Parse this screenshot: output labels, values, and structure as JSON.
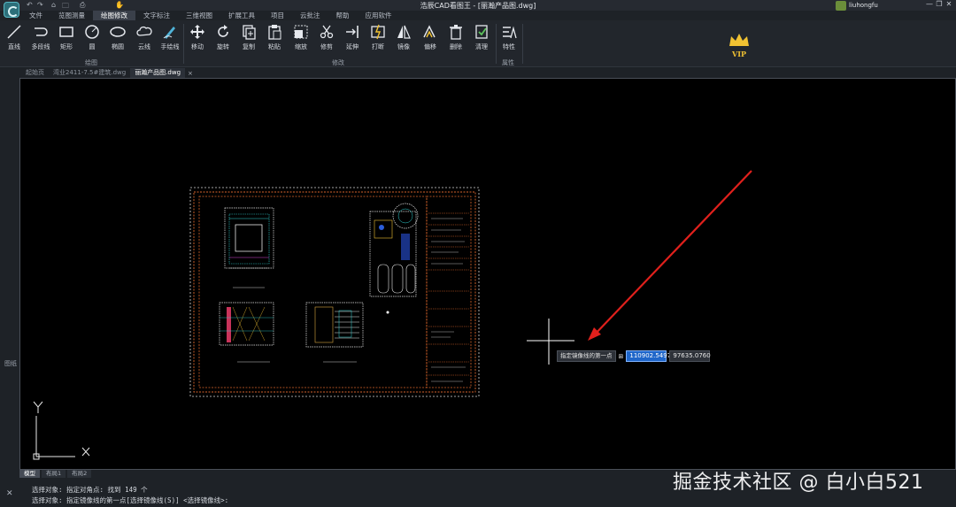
{
  "window": {
    "title": "浩辰CAD看图王 - [丽瀚产品图.dwg]",
    "user_name": "liuhongfu",
    "controls": [
      "—",
      "❐",
      "✕"
    ]
  },
  "quick_access": [
    "↶",
    "↷",
    "⌂",
    "⎙",
    "🗀",
    "✋"
  ],
  "menu": [
    "文件",
    "览图测量",
    "绘图修改",
    "文字标注",
    "三维视图",
    "扩展工具",
    "项目",
    "云批注",
    "帮助",
    "应用软件"
  ],
  "menu_active_index": 2,
  "ribbon": {
    "draw_tools": [
      {
        "label": "直线",
        "icon": "line-icon"
      },
      {
        "label": "多段线",
        "icon": "polyline-icon"
      },
      {
        "label": "矩形",
        "icon": "rectangle-icon"
      },
      {
        "label": "圆",
        "icon": "circle-icon"
      },
      {
        "label": "椭圆",
        "icon": "ellipse-icon"
      },
      {
        "label": "云线",
        "icon": "cloud-icon"
      },
      {
        "label": "手绘线",
        "icon": "pen-icon"
      }
    ],
    "modify_tools": [
      {
        "label": "移动",
        "icon": "move-icon"
      },
      {
        "label": "旋转",
        "icon": "rotate-icon"
      },
      {
        "label": "复制",
        "icon": "copy-icon"
      },
      {
        "label": "粘贴",
        "icon": "paste-icon"
      },
      {
        "label": "缩放",
        "icon": "scale-icon"
      },
      {
        "label": "修剪",
        "icon": "trim-icon"
      },
      {
        "label": "延伸",
        "icon": "extend-icon"
      },
      {
        "label": "打断",
        "icon": "break-icon"
      },
      {
        "label": "镜像",
        "icon": "mirror-icon"
      },
      {
        "label": "偏移",
        "icon": "offset-icon"
      },
      {
        "label": "删除",
        "icon": "delete-icon"
      },
      {
        "label": "清理",
        "icon": "purge-icon"
      }
    ],
    "property_tools": [
      {
        "label": "特性",
        "icon": "properties-icon"
      }
    ],
    "groups": {
      "draw": "绘图",
      "modify": "修改",
      "properties": "属性"
    },
    "vip_label": "VIP"
  },
  "doc_tabs": [
    "起始页",
    "湾业2411-7.5#建筑.dwg",
    "丽瀚产品图.dwg"
  ],
  "doc_tab_active_index": 2,
  "tab_close": "×",
  "leftstrip_label": "图纸",
  "canvas": {
    "axis_y_label": "Y",
    "axis_x_label": "X"
  },
  "dynamic_input": {
    "prompt": "指定镜像线的第一点",
    "lock": "⊞",
    "x_value": "110902.5497",
    "y_value": "97635.0760"
  },
  "layout_tabs": [
    "模型",
    "布局1",
    "布局2"
  ],
  "layout_tab_active_index": 0,
  "command_history": [
    "选择对象: 指定对角点: 找到 149 个",
    "选择对象: 指定镜像线的第一点[选择镜像线(S)] <选择镜像线>:"
  ],
  "command_close": "✕",
  "watermark": "掘金技术社区 @ 白小白521",
  "colors": {
    "accent_blue": "#1f66c9",
    "arrow_red": "#e0201c",
    "drawing_orange": "#d9652b",
    "vip_gold": "#f1c232"
  }
}
